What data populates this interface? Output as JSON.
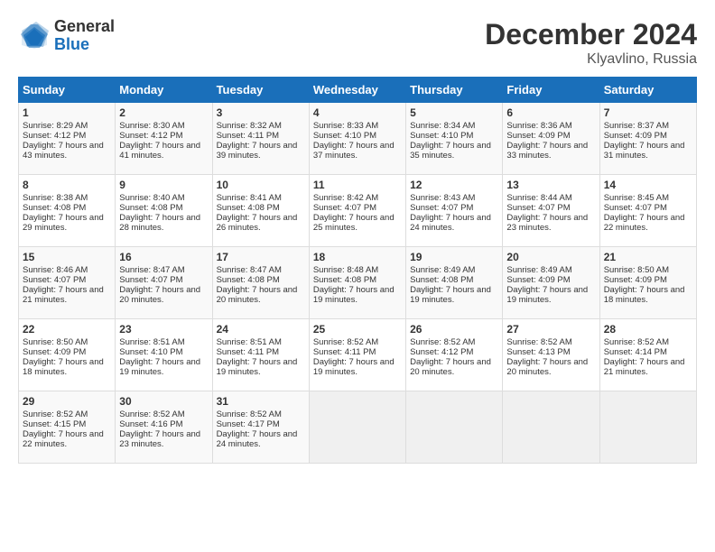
{
  "header": {
    "logo_general": "General",
    "logo_blue": "Blue",
    "title": "December 2024",
    "subtitle": "Klyavlino, Russia"
  },
  "days_of_week": [
    "Sunday",
    "Monday",
    "Tuesday",
    "Wednesday",
    "Thursday",
    "Friday",
    "Saturday"
  ],
  "weeks": [
    [
      {
        "day": "1",
        "sunrise": "Sunrise: 8:29 AM",
        "sunset": "Sunset: 4:12 PM",
        "daylight": "Daylight: 7 hours and 43 minutes."
      },
      {
        "day": "2",
        "sunrise": "Sunrise: 8:30 AM",
        "sunset": "Sunset: 4:12 PM",
        "daylight": "Daylight: 7 hours and 41 minutes."
      },
      {
        "day": "3",
        "sunrise": "Sunrise: 8:32 AM",
        "sunset": "Sunset: 4:11 PM",
        "daylight": "Daylight: 7 hours and 39 minutes."
      },
      {
        "day": "4",
        "sunrise": "Sunrise: 8:33 AM",
        "sunset": "Sunset: 4:10 PM",
        "daylight": "Daylight: 7 hours and 37 minutes."
      },
      {
        "day": "5",
        "sunrise": "Sunrise: 8:34 AM",
        "sunset": "Sunset: 4:10 PM",
        "daylight": "Daylight: 7 hours and 35 minutes."
      },
      {
        "day": "6",
        "sunrise": "Sunrise: 8:36 AM",
        "sunset": "Sunset: 4:09 PM",
        "daylight": "Daylight: 7 hours and 33 minutes."
      },
      {
        "day": "7",
        "sunrise": "Sunrise: 8:37 AM",
        "sunset": "Sunset: 4:09 PM",
        "daylight": "Daylight: 7 hours and 31 minutes."
      }
    ],
    [
      {
        "day": "8",
        "sunrise": "Sunrise: 8:38 AM",
        "sunset": "Sunset: 4:08 PM",
        "daylight": "Daylight: 7 hours and 29 minutes."
      },
      {
        "day": "9",
        "sunrise": "Sunrise: 8:40 AM",
        "sunset": "Sunset: 4:08 PM",
        "daylight": "Daylight: 7 hours and 28 minutes."
      },
      {
        "day": "10",
        "sunrise": "Sunrise: 8:41 AM",
        "sunset": "Sunset: 4:08 PM",
        "daylight": "Daylight: 7 hours and 26 minutes."
      },
      {
        "day": "11",
        "sunrise": "Sunrise: 8:42 AM",
        "sunset": "Sunset: 4:07 PM",
        "daylight": "Daylight: 7 hours and 25 minutes."
      },
      {
        "day": "12",
        "sunrise": "Sunrise: 8:43 AM",
        "sunset": "Sunset: 4:07 PM",
        "daylight": "Daylight: 7 hours and 24 minutes."
      },
      {
        "day": "13",
        "sunrise": "Sunrise: 8:44 AM",
        "sunset": "Sunset: 4:07 PM",
        "daylight": "Daylight: 7 hours and 23 minutes."
      },
      {
        "day": "14",
        "sunrise": "Sunrise: 8:45 AM",
        "sunset": "Sunset: 4:07 PM",
        "daylight": "Daylight: 7 hours and 22 minutes."
      }
    ],
    [
      {
        "day": "15",
        "sunrise": "Sunrise: 8:46 AM",
        "sunset": "Sunset: 4:07 PM",
        "daylight": "Daylight: 7 hours and 21 minutes."
      },
      {
        "day": "16",
        "sunrise": "Sunrise: 8:47 AM",
        "sunset": "Sunset: 4:07 PM",
        "daylight": "Daylight: 7 hours and 20 minutes."
      },
      {
        "day": "17",
        "sunrise": "Sunrise: 8:47 AM",
        "sunset": "Sunset: 4:08 PM",
        "daylight": "Daylight: 7 hours and 20 minutes."
      },
      {
        "day": "18",
        "sunrise": "Sunrise: 8:48 AM",
        "sunset": "Sunset: 4:08 PM",
        "daylight": "Daylight: 7 hours and 19 minutes."
      },
      {
        "day": "19",
        "sunrise": "Sunrise: 8:49 AM",
        "sunset": "Sunset: 4:08 PM",
        "daylight": "Daylight: 7 hours and 19 minutes."
      },
      {
        "day": "20",
        "sunrise": "Sunrise: 8:49 AM",
        "sunset": "Sunset: 4:09 PM",
        "daylight": "Daylight: 7 hours and 19 minutes."
      },
      {
        "day": "21",
        "sunrise": "Sunrise: 8:50 AM",
        "sunset": "Sunset: 4:09 PM",
        "daylight": "Daylight: 7 hours and 18 minutes."
      }
    ],
    [
      {
        "day": "22",
        "sunrise": "Sunrise: 8:50 AM",
        "sunset": "Sunset: 4:09 PM",
        "daylight": "Daylight: 7 hours and 18 minutes."
      },
      {
        "day": "23",
        "sunrise": "Sunrise: 8:51 AM",
        "sunset": "Sunset: 4:10 PM",
        "daylight": "Daylight: 7 hours and 19 minutes."
      },
      {
        "day": "24",
        "sunrise": "Sunrise: 8:51 AM",
        "sunset": "Sunset: 4:11 PM",
        "daylight": "Daylight: 7 hours and 19 minutes."
      },
      {
        "day": "25",
        "sunrise": "Sunrise: 8:52 AM",
        "sunset": "Sunset: 4:11 PM",
        "daylight": "Daylight: 7 hours and 19 minutes."
      },
      {
        "day": "26",
        "sunrise": "Sunrise: 8:52 AM",
        "sunset": "Sunset: 4:12 PM",
        "daylight": "Daylight: 7 hours and 20 minutes."
      },
      {
        "day": "27",
        "sunrise": "Sunrise: 8:52 AM",
        "sunset": "Sunset: 4:13 PM",
        "daylight": "Daylight: 7 hours and 20 minutes."
      },
      {
        "day": "28",
        "sunrise": "Sunrise: 8:52 AM",
        "sunset": "Sunset: 4:14 PM",
        "daylight": "Daylight: 7 hours and 21 minutes."
      }
    ],
    [
      {
        "day": "29",
        "sunrise": "Sunrise: 8:52 AM",
        "sunset": "Sunset: 4:15 PM",
        "daylight": "Daylight: 7 hours and 22 minutes."
      },
      {
        "day": "30",
        "sunrise": "Sunrise: 8:52 AM",
        "sunset": "Sunset: 4:16 PM",
        "daylight": "Daylight: 7 hours and 23 minutes."
      },
      {
        "day": "31",
        "sunrise": "Sunrise: 8:52 AM",
        "sunset": "Sunset: 4:17 PM",
        "daylight": "Daylight: 7 hours and 24 minutes."
      },
      null,
      null,
      null,
      null
    ]
  ]
}
